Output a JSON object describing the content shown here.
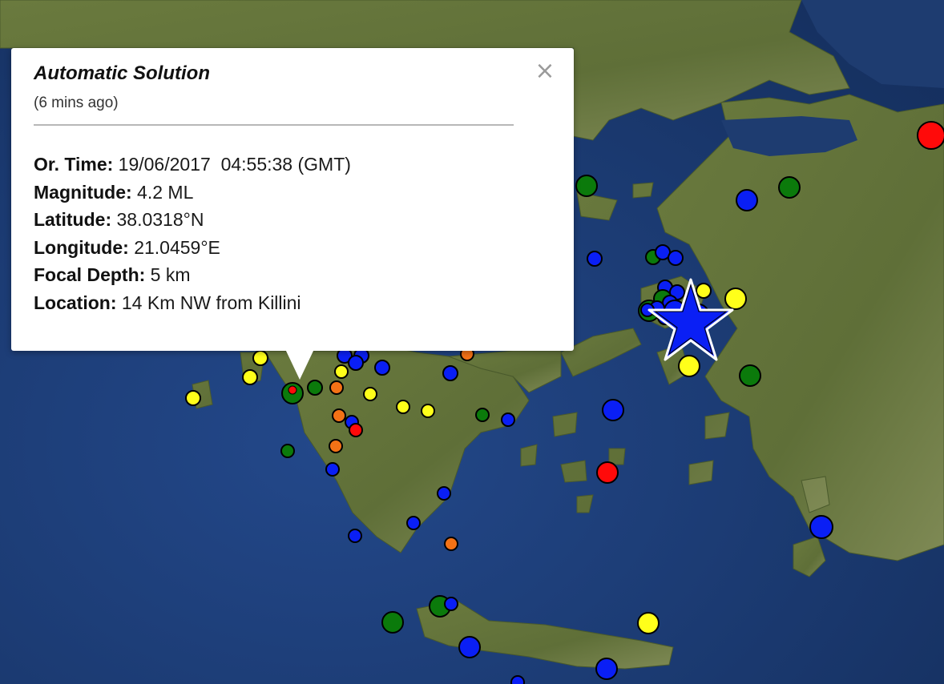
{
  "popup": {
    "title": "Automatic Solution",
    "time_ago": "(6 mins ago)",
    "close_icon": "close-icon",
    "fields": [
      {
        "key": "Or. Time:",
        "value": "19/06/2017  04:55:38 (GMT)"
      },
      {
        "key": "Magnitude:",
        "value": "4.2 ML"
      },
      {
        "key": "Latitude:",
        "value": "38.0318°N"
      },
      {
        "key": "Longitude:",
        "value": "21.0459°E"
      },
      {
        "key": "Focal Depth:",
        "value": "5 km"
      },
      {
        "key": "Location:",
        "value": "14 Km NW from Killini"
      }
    ]
  },
  "map": {
    "basemap": "satellite",
    "colors": {
      "sea": "#1c3a6b",
      "land": "#5a6b35",
      "marker_blue": "#0a1ff5",
      "marker_green": "#0b7a0b",
      "marker_yellow": "#ffff1a",
      "marker_orange": "#f47216",
      "marker_red": "#ff0a0a",
      "star_fill": "#0a1ff5",
      "star_outline": "#ffffff"
    },
    "latest_event_marker": "star-icon"
  }
}
